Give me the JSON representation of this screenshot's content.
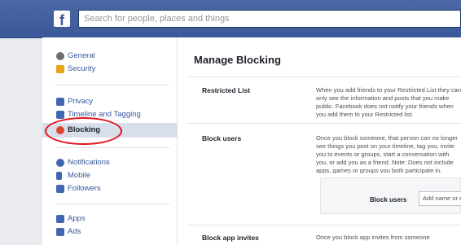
{
  "topbar": {
    "logo_text": "f",
    "search_placeholder": "Search for people, places and things"
  },
  "sidebar": {
    "items": [
      {
        "label": "General",
        "icon": "gear-icon",
        "color": "#6d6d6d"
      },
      {
        "label": "Security",
        "icon": "lock-icon",
        "color": "#e7a217"
      },
      {
        "label": "Privacy",
        "icon": "privacy-icon",
        "color": "#4267b2"
      },
      {
        "label": "Timeline and Tagging",
        "icon": "timeline-icon",
        "color": "#4267b2"
      },
      {
        "label": "Blocking",
        "icon": "block-icon",
        "color": "#e0442b"
      },
      {
        "label": "Notifications",
        "icon": "globe-icon",
        "color": "#4267b2"
      },
      {
        "label": "Mobile",
        "icon": "mobile-icon",
        "color": "#4267b2"
      },
      {
        "label": "Followers",
        "icon": "followers-icon",
        "color": "#4267b2"
      },
      {
        "label": "Apps",
        "icon": "apps-icon",
        "color": "#4267b2"
      },
      {
        "label": "Ads",
        "icon": "ads-icon",
        "color": "#4267b2"
      }
    ]
  },
  "main": {
    "heading": "Manage Blocking",
    "rows": [
      {
        "title": "Restricted List",
        "desc": "When you add friends to your Restricted List they can only see the information and posts that you make public. Facebook does not notify your friends when you add them to your Restricted list."
      },
      {
        "title": "Block users",
        "desc": "Once you block someone, that person can no longer see things you post on your timeline, tag you, invite you to events or groups, start a conversation with you, or add you as a friend. Note: Does not include apps, games or groups you both participate in."
      },
      {
        "title": "Block app invites",
        "desc": "Once you block app invites from someone"
      }
    ],
    "block_users_label": "Block users",
    "block_users_placeholder": "Add name or email"
  }
}
